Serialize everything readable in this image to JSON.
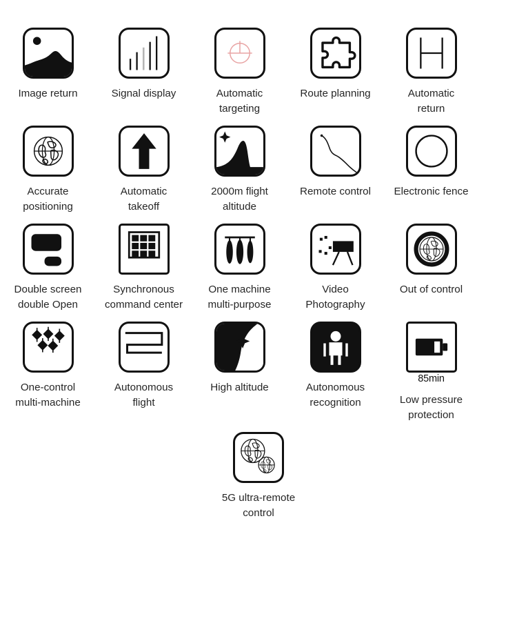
{
  "page": {
    "background_color": "#ffffff",
    "text_color": "#262626",
    "icon_stroke_color": "#111111",
    "accent_color": "#e8a0a0"
  },
  "rows": [
    {
      "items": [
        {
          "icon": "image-return-icon",
          "label": "Image return"
        },
        {
          "icon": "signal-display-icon",
          "label": "Signal display"
        },
        {
          "icon": "automatic-targeting-icon",
          "label": "Automatic\ntargeting"
        },
        {
          "icon": "route-planning-icon",
          "label": "Route planning"
        },
        {
          "icon": "automatic-return-icon",
          "label": "Automatic\nreturn"
        }
      ]
    },
    {
      "items": [
        {
          "icon": "accurate-positioning-icon",
          "label": "Accurate\npositioning"
        },
        {
          "icon": "automatic-takeoff-icon",
          "label": "Automatic\ntakeoff"
        },
        {
          "icon": "flight-altitude-icon",
          "label": "2000m flight\naltitude"
        },
        {
          "icon": "remote-control-icon",
          "label": "Remote control"
        },
        {
          "icon": "electronic-fence-icon",
          "label": "Electronic fence"
        }
      ]
    },
    {
      "items": [
        {
          "icon": "double-screen-icon",
          "label": "Double screen\ndouble Open"
        },
        {
          "icon": "synchronous-command-center-icon",
          "label": "Synchronous\ncommand center"
        },
        {
          "icon": "one-machine-multi-purpose-icon",
          "label": "One machine\nmulti-purpose"
        },
        {
          "icon": "video-photography-icon",
          "label": "Video\nPhotography"
        },
        {
          "icon": "out-of-control-icon",
          "label": "Out of control"
        }
      ]
    },
    {
      "items": [
        {
          "icon": "one-control-multi-machine-icon",
          "label": "One-control\nmulti-machine"
        },
        {
          "icon": "autonomous-flight-icon",
          "label": "Autonomous\nflight"
        },
        {
          "icon": "high-altitude-icon",
          "label": "High altitude"
        },
        {
          "icon": "autonomous-recognition-icon",
          "label": "Autonomous\nrecognition"
        },
        {
          "icon": "low-pressure-protection-icon",
          "label": "Low pressure\nprotection",
          "sub_label": "85min"
        }
      ]
    },
    {
      "single": true,
      "items": [
        {
          "icon": "five-g-remote-control-icon",
          "label": "5G ultra-remote control"
        }
      ]
    }
  ]
}
